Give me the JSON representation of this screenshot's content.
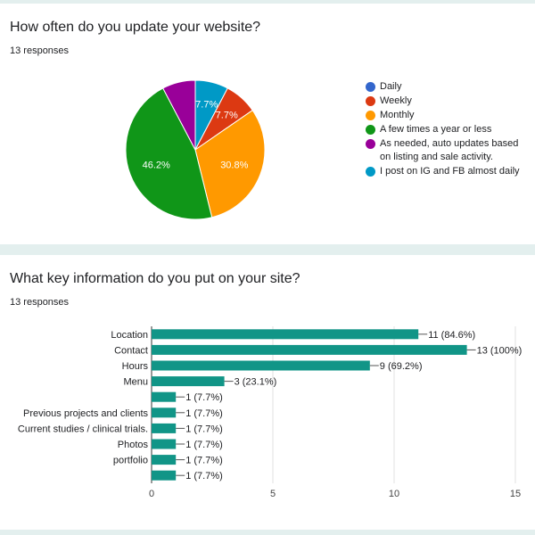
{
  "charts": [
    {
      "question": "How often do you update your website?",
      "responses": "13 responses"
    },
    {
      "question": "What key information do you put on your site?",
      "responses": "13 responses"
    }
  ],
  "chart_data": [
    {
      "type": "pie",
      "title": "How often do you update your website?",
      "slices": [
        {
          "label": "Daily",
          "value": 0,
          "color": "#3366cc"
        },
        {
          "label": "Weekly",
          "value": 7.7,
          "display": "7.7%",
          "color": "#dc3912"
        },
        {
          "label": "Monthly",
          "value": 30.8,
          "display": "30.8%",
          "color": "#ff9900"
        },
        {
          "label": "A few times a year or less",
          "value": 46.2,
          "display": "46.2%",
          "color": "#109618"
        },
        {
          "label": "As needed, auto updates based on listing and sale activity.",
          "value": 7.7,
          "display": "",
          "color": "#990099"
        },
        {
          "label": "I post on IG and FB almost daily",
          "value": 7.7,
          "display": "7.7%",
          "color": "#0099c6"
        }
      ],
      "legend": "right"
    },
    {
      "type": "bar",
      "orientation": "horizontal",
      "title": "What key information do you put on your site?",
      "categories": [
        "Location",
        "Contact",
        "Hours",
        "Menu",
        "",
        "Previous projects and clients",
        "Current studies / clinical trials.",
        "Photos",
        "portfolio",
        ""
      ],
      "values": [
        11,
        13,
        9,
        3,
        1,
        1,
        1,
        1,
        1,
        1
      ],
      "labels": [
        "11 (84.6%)",
        "13 (100%)",
        "9 (69.2%)",
        "3 (23.1%)",
        "1 (7.7%)",
        "1 (7.7%)",
        "1 (7.7%)",
        "1 (7.7%)",
        "1 (7.7%)",
        "1 (7.7%)"
      ],
      "xlim": [
        0,
        15
      ],
      "xticks": [
        "0",
        "5",
        "10",
        "15"
      ],
      "color": "#119587",
      "grid": true
    }
  ]
}
